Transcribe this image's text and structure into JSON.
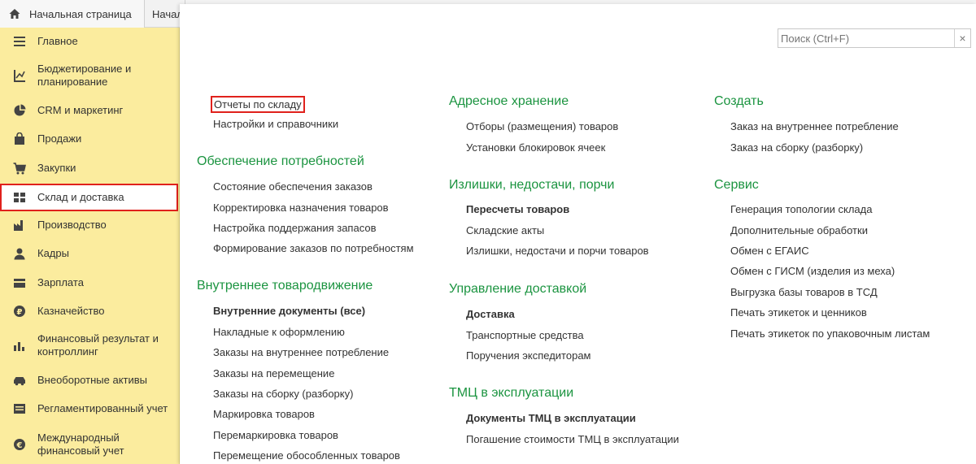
{
  "tabs": {
    "home_label": "Начальная страница",
    "second_label": "Начал"
  },
  "sidebar": {
    "items": [
      {
        "label": "Главное",
        "icon": "menu-lines-icon"
      },
      {
        "label": "Бюджетирование и планирование",
        "icon": "budget-chart-icon"
      },
      {
        "label": "CRM и маркетинг",
        "icon": "pie-chart-icon"
      },
      {
        "label": "Продажи",
        "icon": "shopping-bag-icon"
      },
      {
        "label": "Закупки",
        "icon": "cart-icon"
      },
      {
        "label": "Склад и доставка",
        "icon": "warehouse-grid-icon",
        "selected": true
      },
      {
        "label": "Производство",
        "icon": "factory-icon"
      },
      {
        "label": "Кадры",
        "icon": "person-icon"
      },
      {
        "label": "Зарплата",
        "icon": "wallet-icon"
      },
      {
        "label": "Казначейство",
        "icon": "ruble-coin-icon"
      },
      {
        "label": "Финансовый результат и контроллинг",
        "icon": "bar-chart-icon"
      },
      {
        "label": "Внеоборотные активы",
        "icon": "car-icon"
      },
      {
        "label": "Регламентированный учет",
        "icon": "ledger-icon"
      },
      {
        "label": "Международный финансовый учет",
        "icon": "euro-coin-icon"
      }
    ]
  },
  "search": {
    "placeholder": "Поиск (Ctrl+F)"
  },
  "columns": {
    "left": {
      "top_links": [
        "Отчеты по складу",
        "Настройки и справочники"
      ],
      "groups": [
        {
          "title": "Обеспечение потребностей",
          "links": [
            "Состояние обеспечения заказов",
            "Корректировка назначения товаров",
            "Настройка поддержания запасов",
            "Формирование заказов по потребностям"
          ]
        },
        {
          "title": "Внутреннее товародвижение",
          "links": [
            "Внутренние документы (все)",
            "Накладные к оформлению",
            "Заказы на внутреннее потребление",
            "Заказы на перемещение",
            "Заказы на сборку (разборку)",
            "Маркировка товаров",
            "Перемаркировка товаров",
            "Перемещение обособленных товаров"
          ]
        }
      ]
    },
    "middle": {
      "groups": [
        {
          "title": "Адресное хранение",
          "links": [
            "Отборы (размещения) товаров",
            "Установки блокировок ячеек"
          ]
        },
        {
          "title": "Излишки, недостачи, порчи",
          "links": [
            "Пересчеты товаров",
            "Складские акты",
            "Излишки, недостачи и порчи товаров"
          ]
        },
        {
          "title": "Управление доставкой",
          "links": [
            "Доставка",
            "Транспортные средства",
            "Поручения экспедиторам"
          ]
        },
        {
          "title": "ТМЦ в эксплуатации",
          "links": [
            "Документы ТМЦ в эксплуатации",
            "Погашение стоимости ТМЦ в эксплуатации"
          ]
        }
      ]
    },
    "right": {
      "groups": [
        {
          "title": "Создать",
          "links": [
            "Заказ на внутреннее потребление",
            "Заказ на сборку (разборку)"
          ]
        },
        {
          "title": "Сервис",
          "links": [
            "Генерация топологии склада",
            "Дополнительные обработки",
            "Обмен с ЕГАИС",
            "Обмен с ГИСМ (изделия из меха)",
            "Выгрузка базы товаров в ТСД",
            "Печать этикеток и ценников",
            "Печать этикеток по упаковочным листам"
          ]
        }
      ]
    }
  },
  "colors": {
    "sidebar_bg": "#fbec9e",
    "group_title": "#1b9440",
    "highlight": "#e0211c"
  }
}
